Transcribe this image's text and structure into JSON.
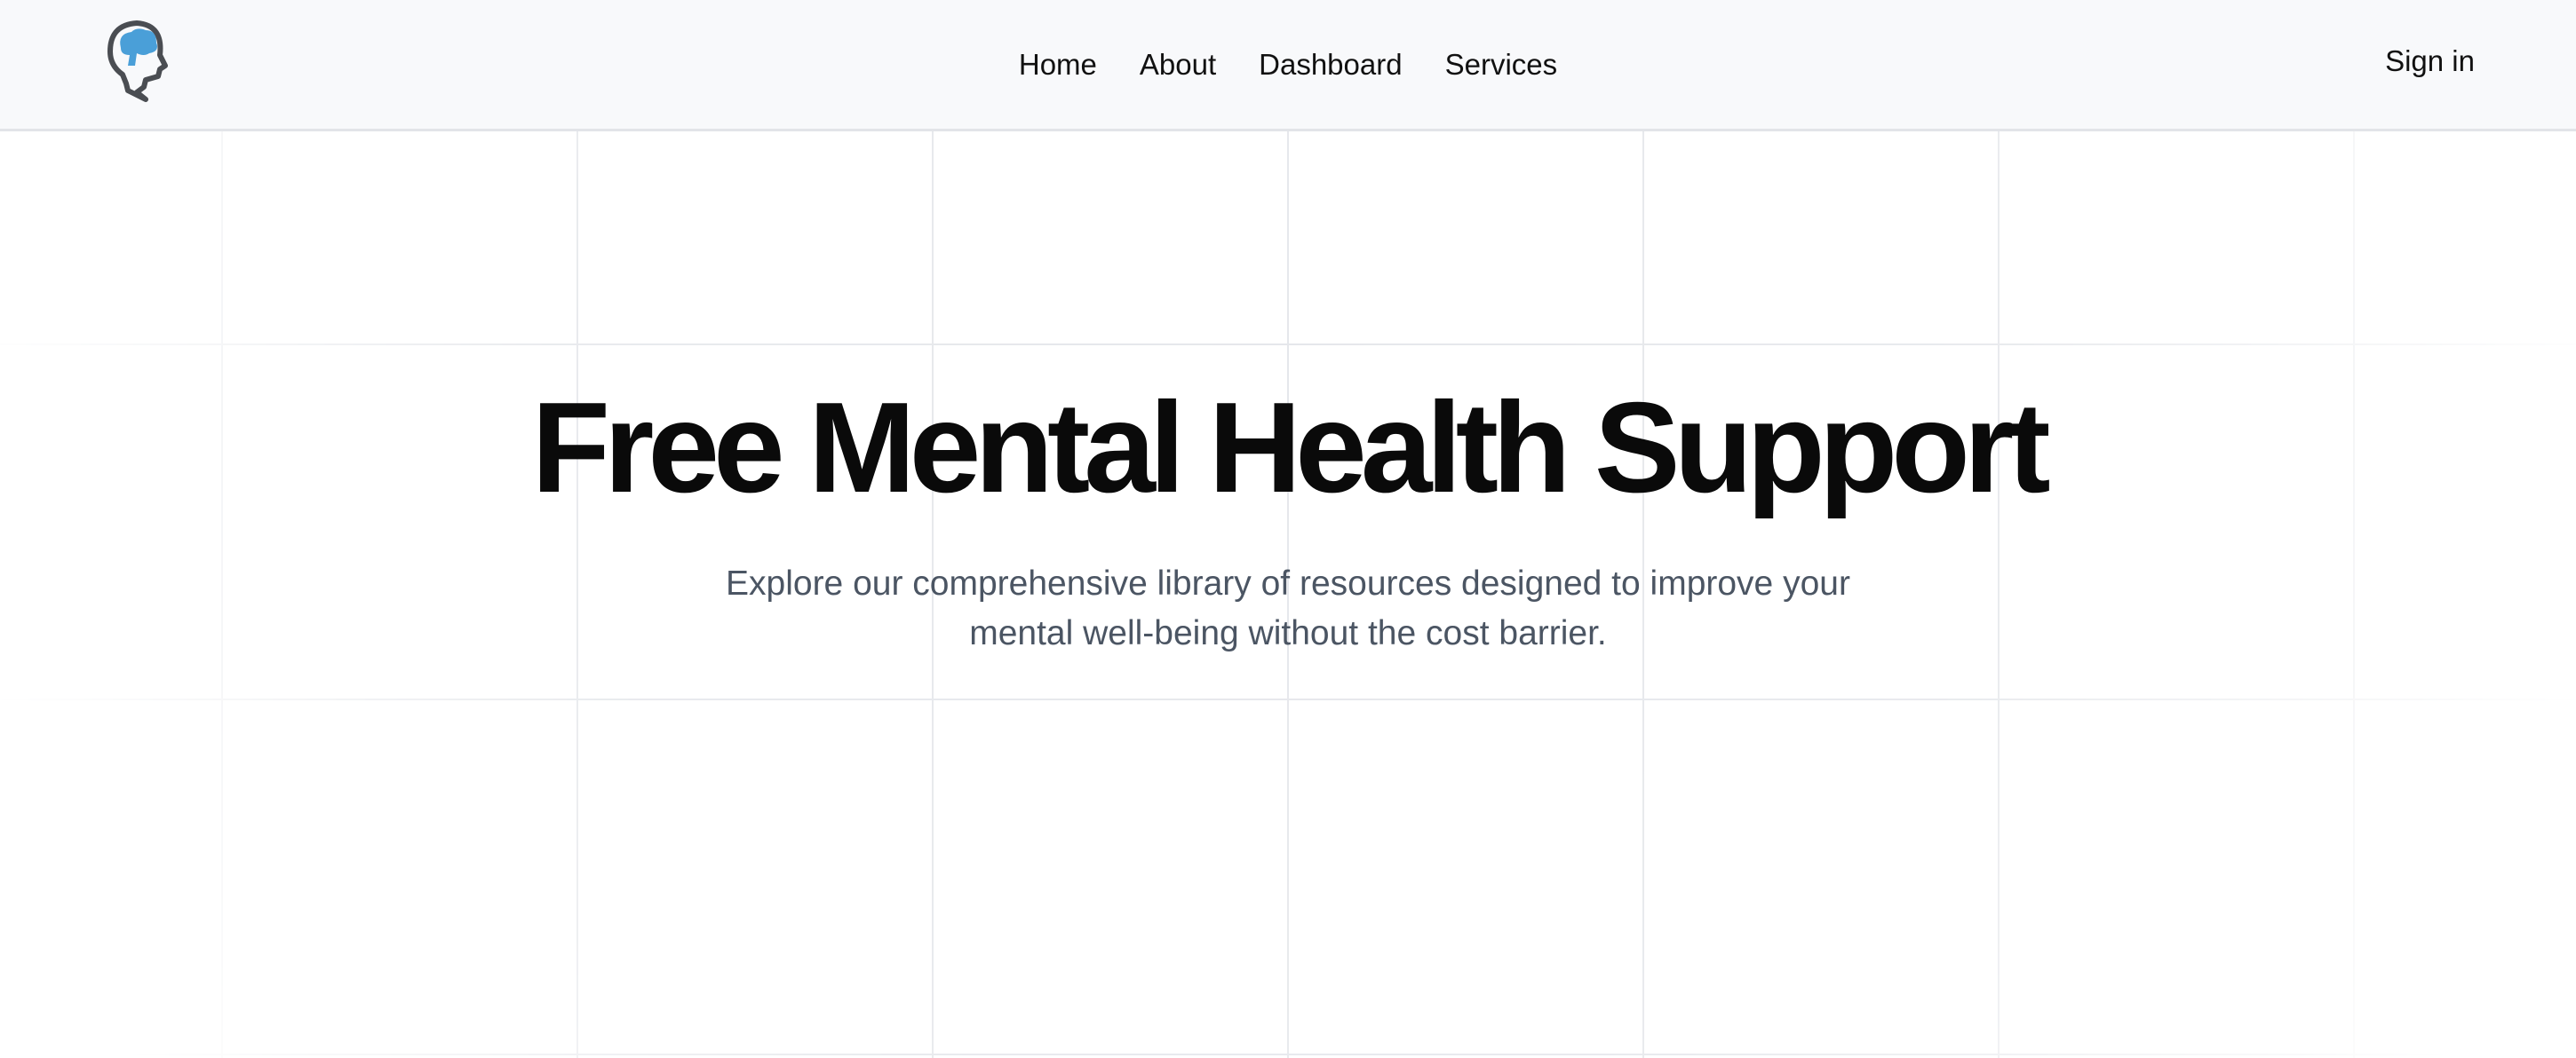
{
  "header": {
    "logo_icon": "brain-head-icon",
    "nav": [
      {
        "label": "Home"
      },
      {
        "label": "About"
      },
      {
        "label": "Dashboard"
      },
      {
        "label": "Services"
      }
    ],
    "sign_in_label": "Sign in"
  },
  "hero": {
    "title": "Free Mental Health Support",
    "subtitle": "Explore our comprehensive library of resources designed to improve your mental well-being without the cost barrier."
  },
  "colors": {
    "accent": "#4a9fd8",
    "navbar_bg": "#f8f9fb",
    "title": "#0a0a0a",
    "subtitle": "#4b5563"
  }
}
